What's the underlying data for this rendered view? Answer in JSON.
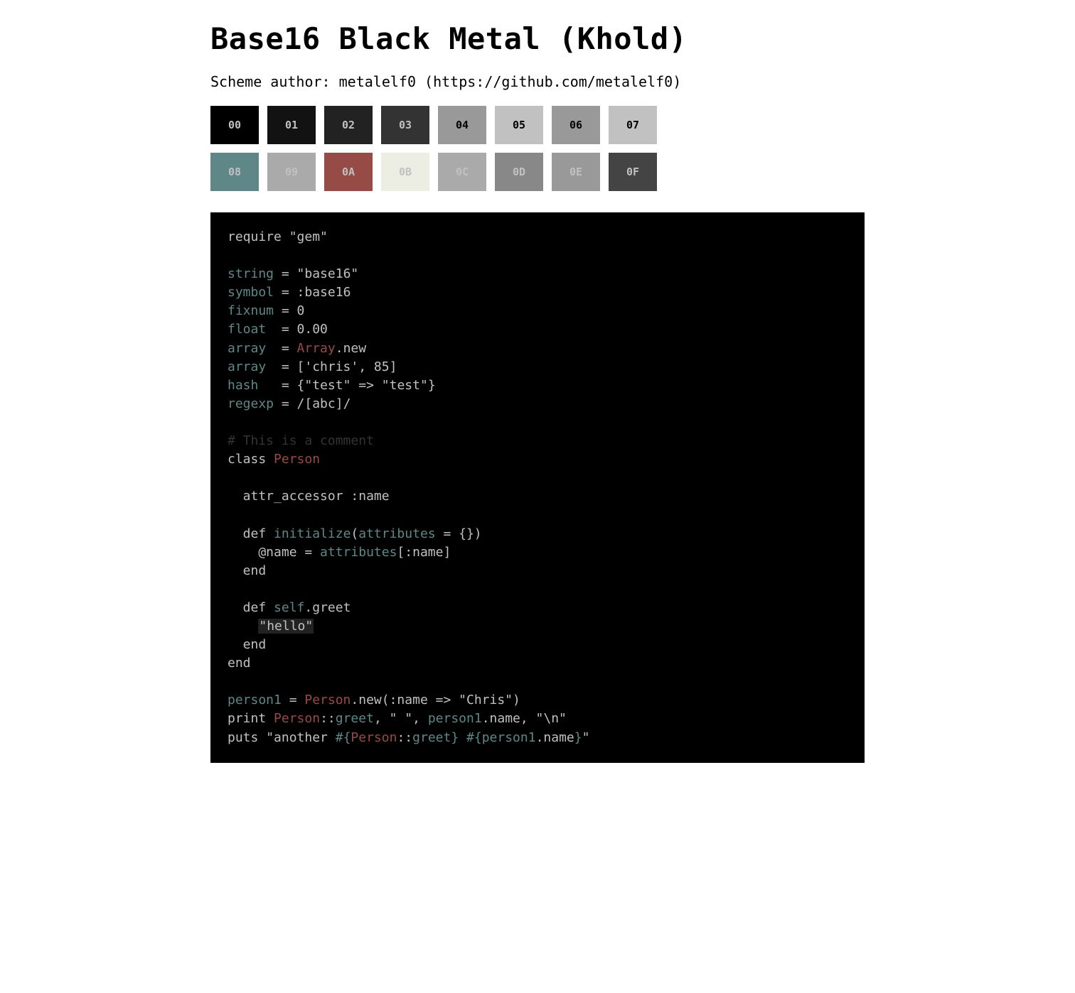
{
  "title": "Base16 Black Metal (Khold)",
  "author": "Scheme author: metalelf0 (https://github.com/metalelf0)",
  "colors": {
    "base00": "#000000",
    "base01": "#121212",
    "base02": "#222222",
    "base03": "#333333",
    "base04": "#999999",
    "base05": "#c1c1c1",
    "base06": "#999999",
    "base07": "#c1c1c1",
    "base08": "#5f8787",
    "base09": "#aaaaaa",
    "base0A": "#974b46",
    "base0B": "#eceee3",
    "base0C": "#aaaaaa",
    "base0D": "#888888",
    "base0E": "#999999",
    "base0F": "#444444"
  },
  "swatches": [
    {
      "label": "00",
      "bg": "base00",
      "fg": "base07"
    },
    {
      "label": "01",
      "bg": "base01",
      "fg": "base07"
    },
    {
      "label": "02",
      "bg": "base02",
      "fg": "base07"
    },
    {
      "label": "03",
      "bg": "base03",
      "fg": "base07"
    },
    {
      "label": "04",
      "bg": "base04",
      "fg": "base00"
    },
    {
      "label": "05",
      "bg": "base05",
      "fg": "base00"
    },
    {
      "label": "06",
      "bg": "base06",
      "fg": "base00"
    },
    {
      "label": "07",
      "bg": "base07",
      "fg": "base00"
    },
    {
      "label": "08",
      "bg": "base08",
      "fg": "base07"
    },
    {
      "label": "09",
      "bg": "base09",
      "fg": "base07"
    },
    {
      "label": "0A",
      "bg": "base0A",
      "fg": "base07"
    },
    {
      "label": "0B",
      "bg": "base0B",
      "fg": "base07"
    },
    {
      "label": "0C",
      "bg": "base0C",
      "fg": "base07"
    },
    {
      "label": "0D",
      "bg": "base0D",
      "fg": "base07"
    },
    {
      "label": "0E",
      "bg": "base0E",
      "fg": "base07"
    },
    {
      "label": "0F",
      "bg": "base0F",
      "fg": "base07"
    }
  ],
  "syntax": {
    "default": "base05",
    "keyword": "base05",
    "variable": "base08",
    "string": "base05",
    "class": "base0A",
    "comment": "base03",
    "identifier": "base08",
    "highlight_bg": "base02",
    "highlight_fg": "base05"
  },
  "code_lines": [
    [
      {
        "t": "require ",
        "c": "default"
      },
      {
        "t": "\"gem\"",
        "c": "string"
      }
    ],
    [],
    [
      {
        "t": "string",
        "c": "variable"
      },
      {
        "t": " = ",
        "c": "default"
      },
      {
        "t": "\"base16\"",
        "c": "string"
      }
    ],
    [
      {
        "t": "symbol",
        "c": "variable"
      },
      {
        "t": " = ",
        "c": "default"
      },
      {
        "t": ":base16",
        "c": "default"
      }
    ],
    [
      {
        "t": "fixnum",
        "c": "variable"
      },
      {
        "t": " = ",
        "c": "default"
      },
      {
        "t": "0",
        "c": "default"
      }
    ],
    [
      {
        "t": "float",
        "c": "variable"
      },
      {
        "t": "  = ",
        "c": "default"
      },
      {
        "t": "0.00",
        "c": "default"
      }
    ],
    [
      {
        "t": "array",
        "c": "variable"
      },
      {
        "t": "  = ",
        "c": "default"
      },
      {
        "t": "Array",
        "c": "class"
      },
      {
        "t": ".new",
        "c": "default"
      }
    ],
    [
      {
        "t": "array",
        "c": "variable"
      },
      {
        "t": "  = [",
        "c": "default"
      },
      {
        "t": "'chris'",
        "c": "string"
      },
      {
        "t": ", ",
        "c": "default"
      },
      {
        "t": "85",
        "c": "default"
      },
      {
        "t": "]",
        "c": "default"
      }
    ],
    [
      {
        "t": "hash",
        "c": "variable"
      },
      {
        "t": "   = {",
        "c": "default"
      },
      {
        "t": "\"test\"",
        "c": "string"
      },
      {
        "t": " => ",
        "c": "default"
      },
      {
        "t": "\"test\"",
        "c": "string"
      },
      {
        "t": "}",
        "c": "default"
      }
    ],
    [
      {
        "t": "regexp",
        "c": "variable"
      },
      {
        "t": " = ",
        "c": "default"
      },
      {
        "t": "/[abc]/",
        "c": "default"
      }
    ],
    [],
    [
      {
        "t": "# This is a comment",
        "c": "comment"
      }
    ],
    [
      {
        "t": "class ",
        "c": "default"
      },
      {
        "t": "Person",
        "c": "class"
      }
    ],
    [],
    [
      {
        "t": "  attr_accessor ",
        "c": "default"
      },
      {
        "t": ":name",
        "c": "default"
      }
    ],
    [],
    [
      {
        "t": "  def ",
        "c": "default"
      },
      {
        "t": "initialize",
        "c": "variable"
      },
      {
        "t": "(",
        "c": "default"
      },
      {
        "t": "attributes",
        "c": "variable"
      },
      {
        "t": " = {})",
        "c": "default"
      }
    ],
    [
      {
        "t": "    @name = ",
        "c": "default"
      },
      {
        "t": "attributes",
        "c": "variable"
      },
      {
        "t": "[",
        "c": "default"
      },
      {
        "t": ":name",
        "c": "default"
      },
      {
        "t": "]",
        "c": "default"
      }
    ],
    [
      {
        "t": "  end",
        "c": "default"
      }
    ],
    [],
    [
      {
        "t": "  def ",
        "c": "default"
      },
      {
        "t": "self",
        "c": "variable"
      },
      {
        "t": ".greet",
        "c": "default"
      }
    ],
    [
      {
        "t": "    ",
        "c": "default"
      },
      {
        "t": "\"hello\"",
        "c": "highlight"
      }
    ],
    [
      {
        "t": "  end",
        "c": "default"
      }
    ],
    [
      {
        "t": "end",
        "c": "default"
      }
    ],
    [],
    [
      {
        "t": "person1",
        "c": "variable"
      },
      {
        "t": " = ",
        "c": "default"
      },
      {
        "t": "Person",
        "c": "class"
      },
      {
        "t": ".new(",
        "c": "default"
      },
      {
        "t": ":name",
        "c": "default"
      },
      {
        "t": " => ",
        "c": "default"
      },
      {
        "t": "\"Chris\"",
        "c": "string"
      },
      {
        "t": ")",
        "c": "default"
      }
    ],
    [
      {
        "t": "print ",
        "c": "default"
      },
      {
        "t": "Person",
        "c": "class"
      },
      {
        "t": "::",
        "c": "default"
      },
      {
        "t": "greet",
        "c": "variable"
      },
      {
        "t": ", ",
        "c": "default"
      },
      {
        "t": "\" \"",
        "c": "string"
      },
      {
        "t": ", ",
        "c": "default"
      },
      {
        "t": "person1",
        "c": "variable"
      },
      {
        "t": ".name, ",
        "c": "default"
      },
      {
        "t": "\"\\n\"",
        "c": "string"
      }
    ],
    [
      {
        "t": "puts ",
        "c": "default"
      },
      {
        "t": "\"another ",
        "c": "string"
      },
      {
        "t": "#{",
        "c": "variable"
      },
      {
        "t": "Person",
        "c": "class"
      },
      {
        "t": "::",
        "c": "default"
      },
      {
        "t": "greet",
        "c": "variable"
      },
      {
        "t": "}",
        "c": "variable"
      },
      {
        "t": " ",
        "c": "string"
      },
      {
        "t": "#{",
        "c": "variable"
      },
      {
        "t": "person1",
        "c": "variable"
      },
      {
        "t": ".name",
        "c": "default"
      },
      {
        "t": "}",
        "c": "variable"
      },
      {
        "t": "\"",
        "c": "string"
      }
    ]
  ]
}
